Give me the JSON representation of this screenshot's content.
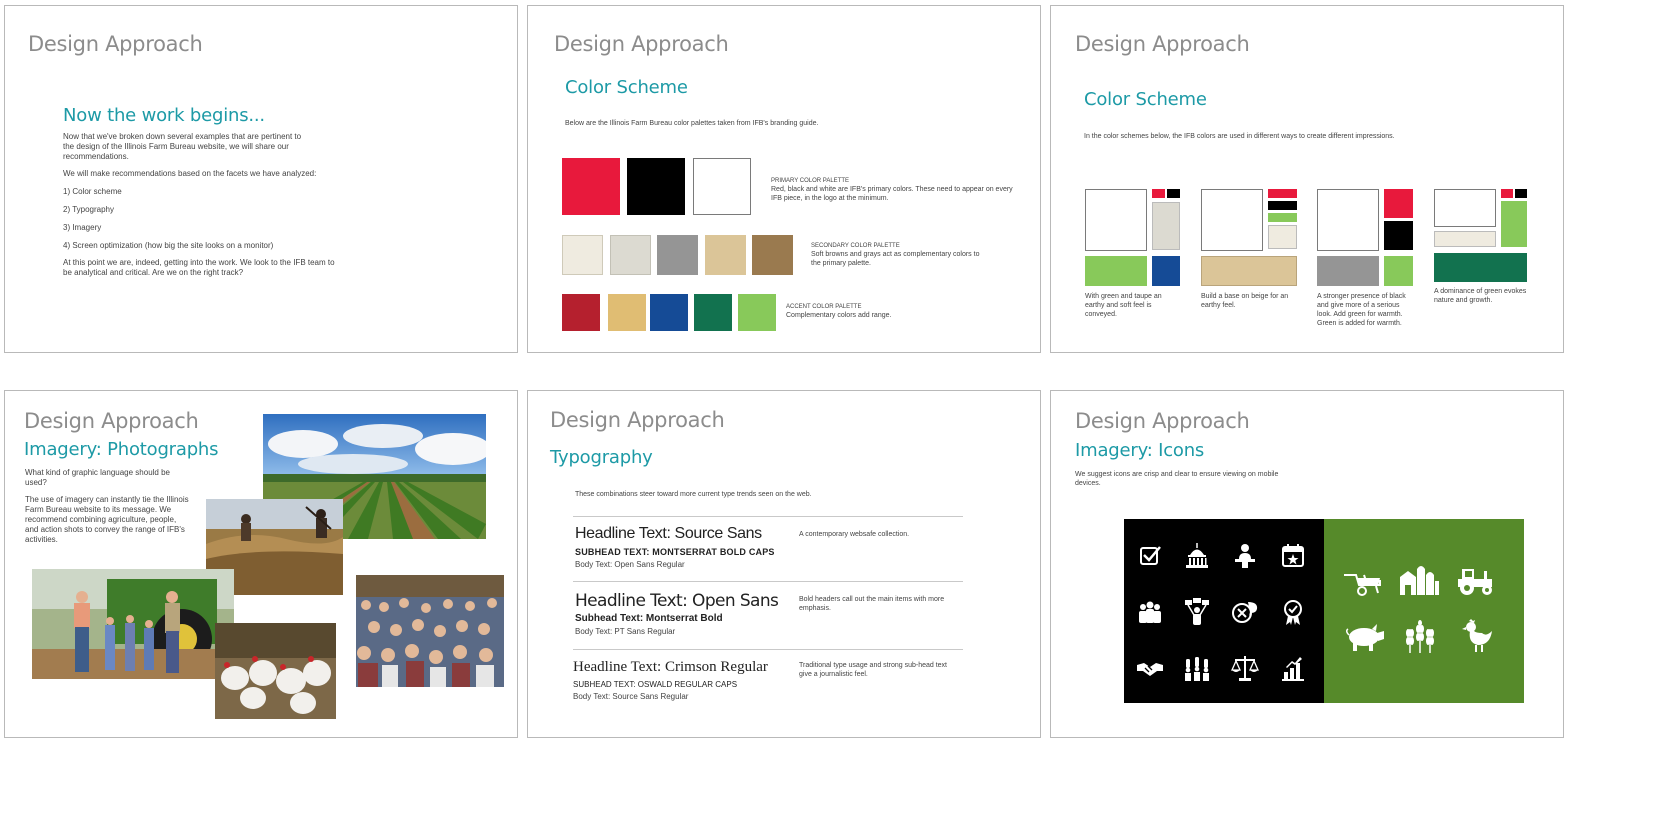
{
  "colors": {
    "teal": "#1d9aa6",
    "gray_title": "#8c8c8c",
    "red": "#e8193c",
    "black": "#000000",
    "white": "#ffffff",
    "cream": "#efebe0",
    "light_gray": "#dcdad1",
    "gray": "#959595",
    "beige": "#dbc598",
    "brown": "#9a7a4f",
    "dark_red": "#b5202e",
    "gold": "#e0bd73",
    "blue": "#154b96",
    "dark_green": "#12724f",
    "light_green": "#88c95a",
    "icon_green": "#568a2a"
  },
  "slide1": {
    "title": "Design Approach",
    "heading": "Now the work begins...",
    "p1": "Now that we've broken down several examples that are pertinent to the design of the Illinois Farm Bureau website, we will share our recommendations.",
    "p2": "We will make recommendations based on the facets we have analyzed:",
    "items": [
      "1) Color scheme",
      "2) Typography",
      "3) Imagery",
      "4) Screen optimization (how big the site looks on a monitor)"
    ],
    "p3": "At this point we are, indeed, getting into the work. We look to the IFB team to be analytical and critical. Are we on the right track?"
  },
  "slide2": {
    "title": "Design Approach",
    "heading": "Color Scheme",
    "intro": "Below are the Illinois Farm Bureau color palettes taken from IFB's branding guide.",
    "primary_label": "PRIMARY COLOR PALETTE",
    "primary_desc": "Red, black and white are IFB's primary colors. These need to appear on every IFB piece, in the logo at the minimum.",
    "secondary_label": "SECONDARY COLOR PALETTE",
    "secondary_desc": "Soft browns and grays act as complementary colors to the primary palette.",
    "accent_label": "ACCENT COLOR PALETTE",
    "accent_desc": "Complementary colors add range."
  },
  "slide3": {
    "title": "Design Approach",
    "heading": "Color Scheme",
    "intro": "In the color schemes below, the IFB colors are used in different ways to create different impressions.",
    "captions": [
      "With green and taupe an earthy and soft feel is conveyed.",
      "Build a base on beige for an earthy feel.",
      "A stronger presence of black and give more of a serious look. Add green for warmth. Green is added for warmth.",
      "A dominance of green evokes nature and growth."
    ]
  },
  "slide4": {
    "title": "Design Approach",
    "heading": "Imagery: Photographs",
    "p1": "What kind of graphic language should be used?",
    "p2": "The use of imagery can instantly tie the Illinois Farm Bureau website to its message. We recommend combining agriculture, people, and action shots to convey the range of IFB's activities."
  },
  "slide5": {
    "title": "Design Approach",
    "heading": "Typography",
    "intro": "These combinations steer toward more current type trends seen on the web.",
    "rows": [
      {
        "headline": "Headline Text: Source Sans",
        "subhead": "SUBHEAD TEXT: MONTSERRAT BOLD CAPS",
        "body": "Body Text: Open Sans Regular",
        "note": "A contemporary websafe collection."
      },
      {
        "headline": "Headline Text: Open Sans",
        "subhead": "Subhead Text: Montserrat Bold",
        "body": "Body Text: PT Sans Regular",
        "note": "Bold headers call out the main items with more emphasis."
      },
      {
        "headline": "Headline Text: Crimson Regular",
        "subhead": "SUBHEAD TEXT: OSWALD REGULAR CAPS",
        "body": "Body Text: Source Sans Regular",
        "note": "Traditional type usage and strong sub-head  text give a journalistic feel."
      }
    ]
  },
  "slide6": {
    "title": "Design Approach",
    "heading": "Imagery: Icons",
    "intro": "We suggest icons are crisp and clear to ensure viewing on mobile devices.",
    "icons_dark": [
      "checkbox-icon",
      "capitol-icon",
      "speaker-icon",
      "calendar-icon",
      "group-icon",
      "ideas-icon",
      "no-chat-icon",
      "award-icon",
      "handshake-icon",
      "raised-hands-icon",
      "scales-icon",
      "growth-chart-icon"
    ],
    "icons_green": [
      "wheelbarrow-icon",
      "farm-icon",
      "tractor-icon",
      "pig-icon",
      "wheat-icon",
      "chicken-icon"
    ]
  }
}
